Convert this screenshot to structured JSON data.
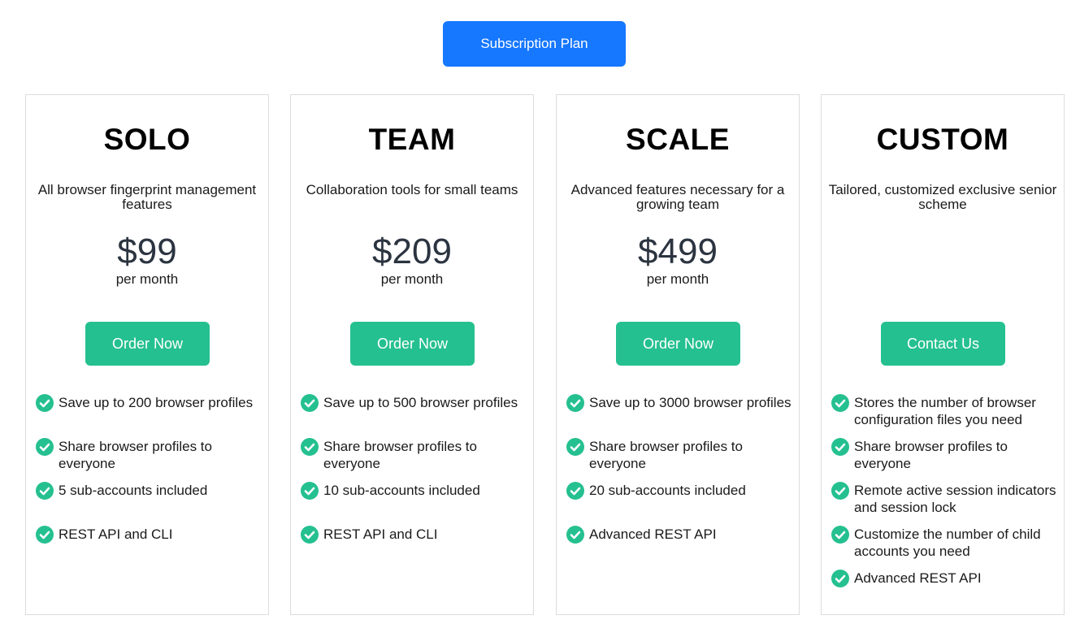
{
  "header": {
    "subscription_button": "Subscription Plan"
  },
  "colors": {
    "primary_button": "#1677ff",
    "order_button": "#25c08f",
    "check_icon": "#25c08f",
    "price_text": "#2b3440"
  },
  "plans": [
    {
      "name": "SOLO",
      "description": "All browser fingerprint management features",
      "price": "$99",
      "period": "per month",
      "button": "Order Now",
      "features": [
        "Save up to 200 browser profiles",
        "Share browser profiles to everyone",
        "5 sub-accounts included",
        "REST API and CLI"
      ]
    },
    {
      "name": "TEAM",
      "description": "Collaboration tools for small teams",
      "price": "$209",
      "period": "per month",
      "button": "Order Now",
      "features": [
        "Save up to 500 browser profiles",
        "Share browser profiles to everyone",
        "10 sub-accounts included",
        "REST API and CLI"
      ]
    },
    {
      "name": "SCALE",
      "description": "Advanced features necessary for a growing team",
      "price": "$499",
      "period": "per month",
      "button": "Order Now",
      "features": [
        "Save up to 3000 browser profiles",
        "Share browser profiles to everyone",
        "20 sub-accounts included",
        "Advanced REST API"
      ]
    },
    {
      "name": "CUSTOM",
      "description": "Tailored, customized exclusive senior scheme",
      "button": "Contact Us",
      "features": [
        "Stores the number of browser configuration files you need",
        "Share browser profiles to everyone",
        "Remote active session indicators and session lock",
        "Customize the number of child accounts you need",
        "Advanced REST API"
      ]
    }
  ]
}
